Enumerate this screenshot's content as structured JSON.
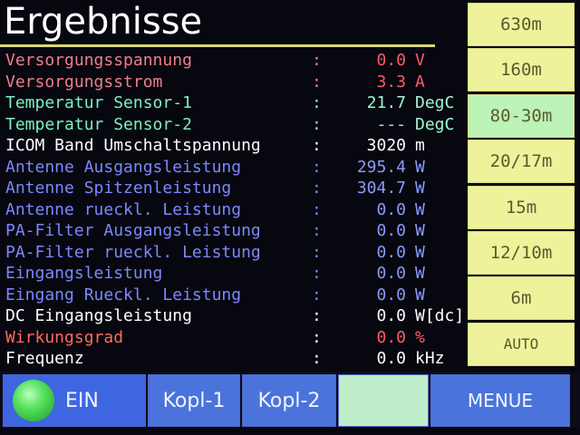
{
  "header": {
    "title": "Ergebnisse"
  },
  "rows": [
    {
      "label": "Versorgungsspannung",
      "sep": ":",
      "value": "0.0",
      "unit": "V"
    },
    {
      "label": "Versorgungsstrom",
      "sep": ":",
      "value": "3.3",
      "unit": "A"
    },
    {
      "label": "Temperatur Sensor-1",
      "sep": ":",
      "value": "21.7",
      "unit": "DegC"
    },
    {
      "label": "Temperatur Sensor-2",
      "sep": ":",
      "value": "---",
      "unit": "DegC"
    },
    {
      "label": "ICOM Band Umschaltspannung",
      "sep": ":",
      "value": "3020",
      "unit": "m"
    },
    {
      "label": "Antenne Ausgangsleistung",
      "sep": ":",
      "value": "295.4",
      "unit": "W"
    },
    {
      "label": "Antenne Spitzenleistung",
      "sep": ":",
      "value": "304.7",
      "unit": "W"
    },
    {
      "label": "Antenne rueckl. Leistung",
      "sep": ":",
      "value": "0.0",
      "unit": "W"
    },
    {
      "label": "PA-Filter Ausgangsleistung",
      "sep": ":",
      "value": "0.0",
      "unit": "W"
    },
    {
      "label": "PA-Filter rueckl. Leistung",
      "sep": ":",
      "value": "0.0",
      "unit": "W"
    },
    {
      "label": "Eingangsleistung",
      "sep": ":",
      "value": "0.0",
      "unit": "W"
    },
    {
      "label": "Eingang Rueckl. Leistung",
      "sep": ":",
      "value": "0.0",
      "unit": "W"
    },
    {
      "label": "DC Eingangsleistung",
      "sep": ":",
      "value": "0.0",
      "unit": "W[dc]"
    },
    {
      "label": "Wirkungsgrad",
      "sep": ":",
      "value": "0.0",
      "unit": "%"
    },
    {
      "label": "Frequenz",
      "sep": ":",
      "value": "0.0",
      "unit": "kHz"
    }
  ],
  "bands": [
    {
      "label": "630m"
    },
    {
      "label": "160m"
    },
    {
      "label": "80-30m"
    },
    {
      "label": "20/17m"
    },
    {
      "label": "15m"
    },
    {
      "label": "12/10m"
    },
    {
      "label": "6m"
    },
    {
      "label": "AUTO"
    }
  ],
  "bottom": {
    "ein": "EIN",
    "kopl1": "Kopl-1",
    "kopl2": "Kopl-2",
    "menue": "MENUE"
  },
  "colors": {
    "band_button": "#eef29a",
    "band_selected": "#bdf3b6",
    "bottom_button": "#4a74dc",
    "power_led": "#55e05a"
  }
}
